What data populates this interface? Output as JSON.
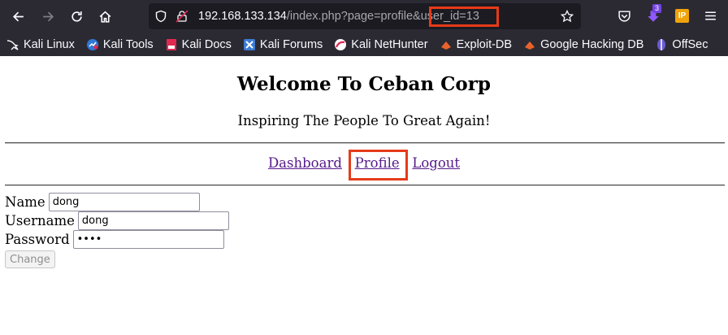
{
  "browser": {
    "url_host": "192.168.133.134",
    "url_path": "/index.php?page=profile&",
    "url_param": "user_id=13",
    "extension_badge": "3",
    "bookmarks": [
      {
        "label": "Kali Linux",
        "icon": "kali-dragon-icon"
      },
      {
        "label": "Kali Tools",
        "icon": "kali-tools-icon"
      },
      {
        "label": "Kali Docs",
        "icon": "kali-docs-icon"
      },
      {
        "label": "Kali Forums",
        "icon": "kali-forums-icon"
      },
      {
        "label": "Kali NetHunter",
        "icon": "nethunter-icon"
      },
      {
        "label": "Exploit-DB",
        "icon": "exploit-db-icon"
      },
      {
        "label": "Google Hacking DB",
        "icon": "ghdb-icon"
      },
      {
        "label": "OffSec",
        "icon": "offsec-icon"
      }
    ]
  },
  "page": {
    "title": "Welcome To Ceban Corp",
    "tagline": "Inspiring The People To Great Again!",
    "nav": {
      "dashboard": "Dashboard",
      "profile": "Profile",
      "logout": "Logout"
    },
    "form": {
      "name_label": "Name",
      "name_value": "dong",
      "username_label": "Username",
      "username_value": "dong",
      "password_label": "Password",
      "password_value": "dong",
      "submit_label": "Change"
    }
  },
  "colors": {
    "chrome_bg": "#2b2a33",
    "urlbar_bg": "#1c1b22",
    "highlight": "#e63b18",
    "visited_link": "#551a8b"
  }
}
